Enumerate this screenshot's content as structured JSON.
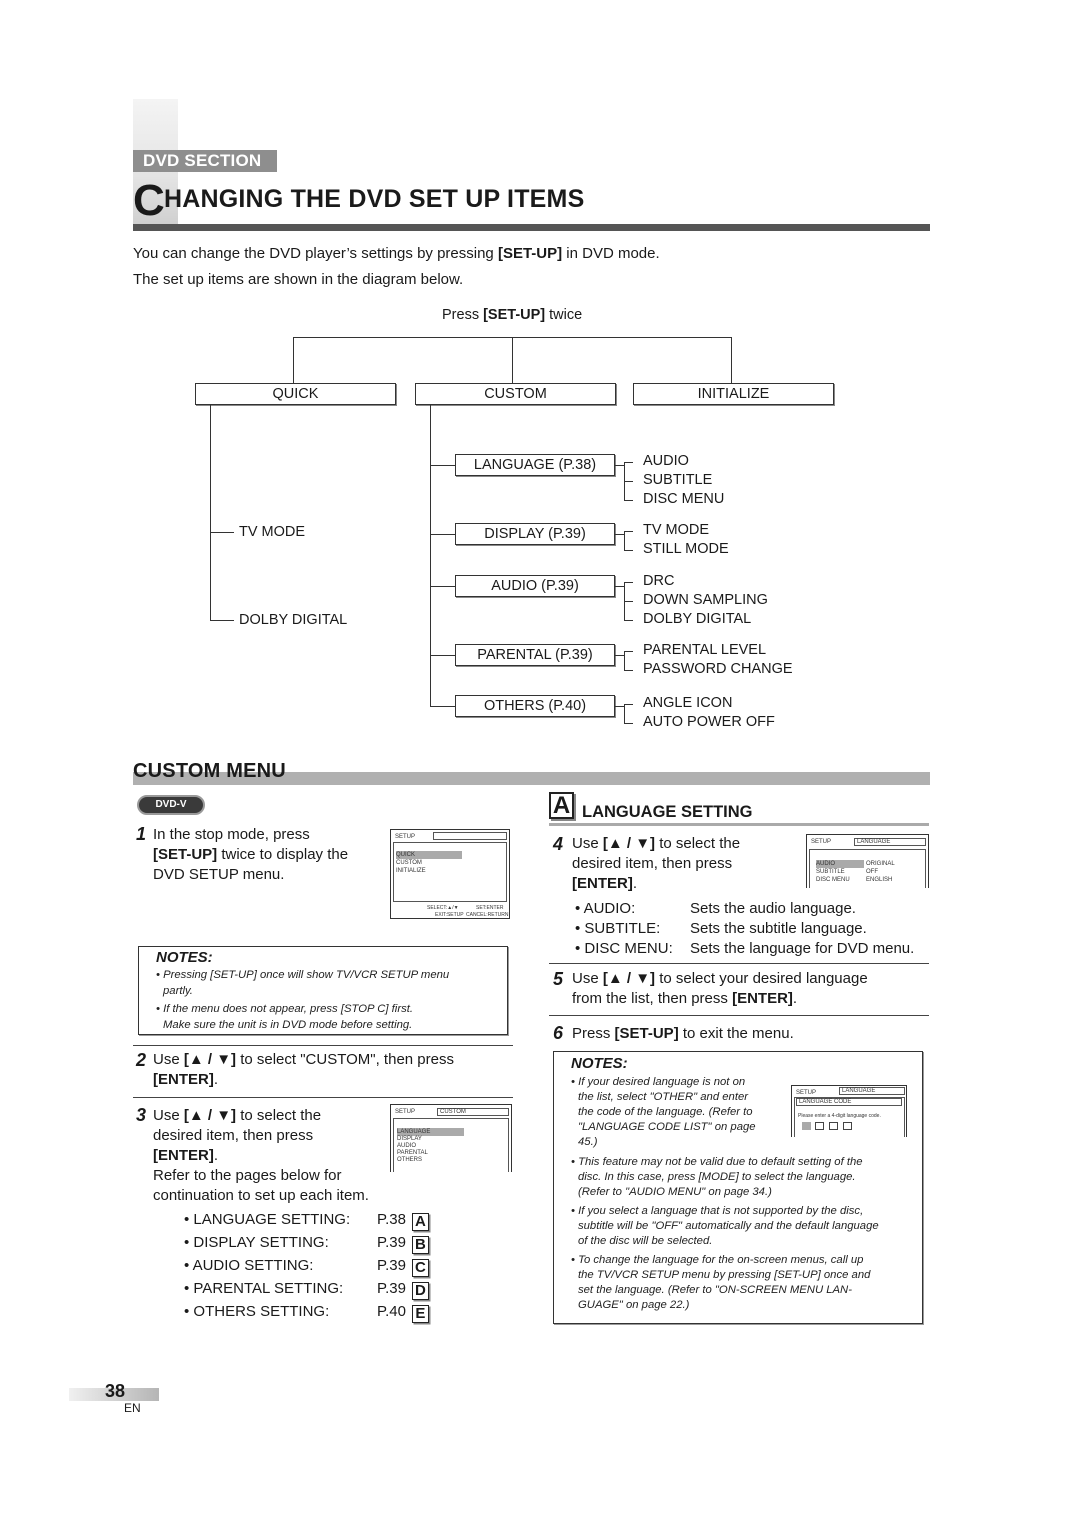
{
  "header": {
    "section_tag": "DVD SECTION",
    "title_dropcap": "C",
    "title_rest": "HANGING THE DVD SET UP ITEMS"
  },
  "intro": {
    "line1_pre": "You can change the DVD player’s settings by pressing ",
    "line1_key": "[SET-UP]",
    "line1_post": " in DVD mode.",
    "line2": "The set up items are shown in the diagram below."
  },
  "diagram": {
    "press_pre": "Press ",
    "press_key": "[SET-UP]",
    "press_post": " twice",
    "top_level": [
      "QUICK",
      "CUSTOM",
      "INITIALIZE"
    ],
    "quick_children": [
      "TV MODE",
      "DOLBY DIGITAL"
    ],
    "custom_children": [
      {
        "label": "LANGUAGE (P.38)",
        "items": [
          "AUDIO",
          "SUBTITLE",
          "DISC MENU"
        ]
      },
      {
        "label": "DISPLAY (P.39)",
        "items": [
          "TV MODE",
          "STILL MODE"
        ]
      },
      {
        "label": "AUDIO (P.39)",
        "items": [
          "DRC",
          "DOWN SAMPLING",
          "DOLBY DIGITAL"
        ]
      },
      {
        "label": "PARENTAL (P.39)",
        "items": [
          "PARENTAL LEVEL",
          "PASSWORD CHANGE"
        ]
      },
      {
        "label": "OTHERS (P.40)",
        "items": [
          "ANGLE ICON",
          "AUTO POWER OFF"
        ]
      }
    ]
  },
  "custom_menu": {
    "title": "CUSTOM MENU",
    "badge": "DVD-V",
    "step1": {
      "num": "1",
      "line1": "In the stop mode, press",
      "key": "[SET-UP]",
      "line2_post": " twice to display the",
      "line3": "DVD SETUP menu."
    },
    "screen1": {
      "head": "SETUP",
      "items": [
        "QUICK",
        "CUSTOM",
        "INITIALIZE"
      ],
      "footer1_left": "SELECT:▲/▼",
      "footer1_right": "SET:ENTER",
      "footer2_left": "EXIT:SETUP",
      "footer2_right": "CANCEL:RETURN"
    },
    "notes1": {
      "title": "NOTES:",
      "items": [
        "• Pressing [SET-UP] once will show TV/VCR SETUP menu",
        "partly.",
        "• If the menu does not appear, press [STOP C] first.",
        "Make sure the unit is in DVD mode before setting."
      ]
    },
    "step2": {
      "num": "2",
      "line1_pre": "Use ",
      "arrows": "[▲ / ▼]",
      "line1_post": " to select \"CUSTOM\", then press",
      "line2_key": "[ENTER]",
      "line2_post": "."
    },
    "step3": {
      "num": "3",
      "line1_pre": "Use ",
      "arrows": "[▲ / ▼]",
      "line1_post": " to select the",
      "line2": "desired item, then press",
      "line3_key": "[ENTER]",
      "line3_post": ".",
      "line4": "Refer to the pages below for",
      "line5": "continuation to set up each item."
    },
    "screen3": {
      "head": "SETUP",
      "title": "CUSTOM",
      "items": [
        "LANGUAGE",
        "DISPLAY",
        "AUDIO",
        "PARENTAL",
        "OTHERS"
      ]
    },
    "settings_list": [
      {
        "label": "• LANGUAGE SETTING:",
        "page": "P.38",
        "letter": "A"
      },
      {
        "label": "• DISPLAY SETTING:",
        "page": "P.39",
        "letter": "B"
      },
      {
        "label": "• AUDIO SETTING:",
        "page": "P.39",
        "letter": "C"
      },
      {
        "label": "• PARENTAL SETTING:",
        "page": "P.39",
        "letter": "D"
      },
      {
        "label": "• OTHERS SETTING:",
        "page": "P.40",
        "letter": "E"
      }
    ]
  },
  "language_setting": {
    "letter": "A",
    "title": "LANGUAGE SETTING",
    "step4": {
      "num": "4",
      "line1_pre": "Use ",
      "arrows": "[▲ / ▼]",
      "line1_post": " to select the",
      "line2": "desired item, then press",
      "line3_key": "[ENTER]",
      "line3_post": "."
    },
    "screen4": {
      "head": "SETUP",
      "title": "LANGUAGE",
      "rows": [
        [
          "AUDIO",
          "ORIGINAL"
        ],
        [
          "SUBTITLE",
          "OFF"
        ],
        [
          "DISC MENU",
          "ENGLISH"
        ]
      ]
    },
    "items": [
      {
        "label": "• AUDIO:",
        "desc": "Sets the audio language."
      },
      {
        "label": "• SUBTITLE:",
        "desc": "Sets the subtitle language."
      },
      {
        "label": "• DISC MENU:",
        "desc": "Sets the language for DVD menu."
      }
    ],
    "step5": {
      "num": "5",
      "line1_pre": "Use ",
      "arrows": "[▲ / ▼]",
      "line1_post": " to select your desired language",
      "line2_pre": "from the list, then press ",
      "line2_key": "[ENTER]",
      "line2_post": "."
    },
    "step6": {
      "num": "6",
      "pre": "Press ",
      "key": "[SET-UP]",
      "post": " to exit the menu."
    },
    "notes2": {
      "title": "NOTES:",
      "item1": [
        "• If your desired language is not on",
        "the list, select \"OTHER\" and enter",
        "the code of the language. (Refer to",
        "\"LANGUAGE CODE LIST\" on page",
        "45.)"
      ],
      "item2": [
        "• This feature may not be valid due to default setting of the",
        "disc. In this case, press [MODE] to select the language.",
        "(Refer to \"AUDIO MENU\" on page 34.)"
      ],
      "item3": [
        "• If you select a language that is not supported by the disc,",
        "subtitle will be \"OFF\" automatically and the default language",
        "of the disc will be selected."
      ],
      "item4": [
        "• To change the language for the on-screen menus, call up",
        "the TV/VCR SETUP menu by pressing [SET-UP] once and",
        "set the language. (Refer to \"ON-SCREEN MENU LAN-",
        "GUAGE\" on page 22.)"
      ]
    },
    "screen_code": {
      "head": "SETUP",
      "title": "LANGUAGE",
      "subtitle": "LANGUAGE CODE",
      "prompt": "Please enter a 4-digit language code."
    }
  },
  "footer": {
    "page_number": "38",
    "lang": "EN"
  }
}
